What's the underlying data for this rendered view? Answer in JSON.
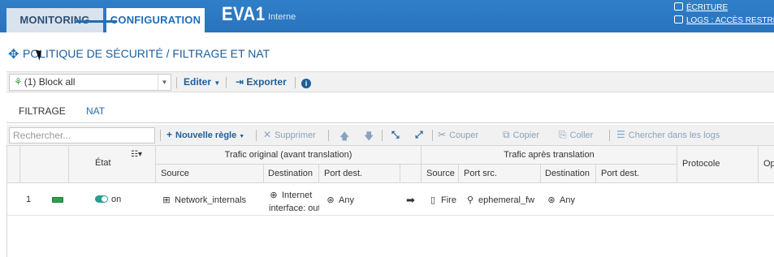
{
  "top_tabs": {
    "monitoring": "MONITORING",
    "configuration": "CONFIGURATION"
  },
  "brand": {
    "name": "EVA1",
    "subtitle": "Interne"
  },
  "top_links": {
    "write": "ÉCRITURE",
    "logs": "LOGS : ACCÈS RESTREINT"
  },
  "breadcrumb": "POLITIQUE DE SÉCURITÉ / FILTRAGE ET NAT",
  "policy_toolbar": {
    "selected_policy": "(1) Block all",
    "edit": "Editer",
    "export": "Exporter"
  },
  "tabs": [
    "FILTRAGE",
    "NAT"
  ],
  "active_tab": "NAT",
  "rule_toolbar": {
    "search_placeholder": "Rechercher...",
    "new_rule": "Nouvelle règle",
    "delete": "Supprimer",
    "cut": "Couper",
    "copy": "Copier",
    "paste": "Coller",
    "search_logs": "Chercher dans les logs"
  },
  "grid": {
    "headers": {
      "state": "État",
      "original_group": "Trafic original (avant translation)",
      "after_group": "Trafic après translation",
      "protocol": "Protocole",
      "options": "Op",
      "source": "Source",
      "destination": "Destination",
      "port_dest": "Port dest.",
      "after_source": "Source",
      "port_src": "Port src.",
      "after_destination": "Destination",
      "after_port_dest": "Port dest."
    },
    "rows": [
      {
        "num": "1",
        "state": "on",
        "source": "Network_internals",
        "destination_line1": "Internet",
        "destination_line2": "interface: out",
        "port_dest": "Any",
        "after_source": "Fire",
        "port_src": "ephemeral_fw",
        "after_destination": "Any"
      }
    ]
  },
  "colors": {
    "topbar": "#2f7fc8",
    "accent": "#1f6db5",
    "led": "#2ea04a"
  }
}
